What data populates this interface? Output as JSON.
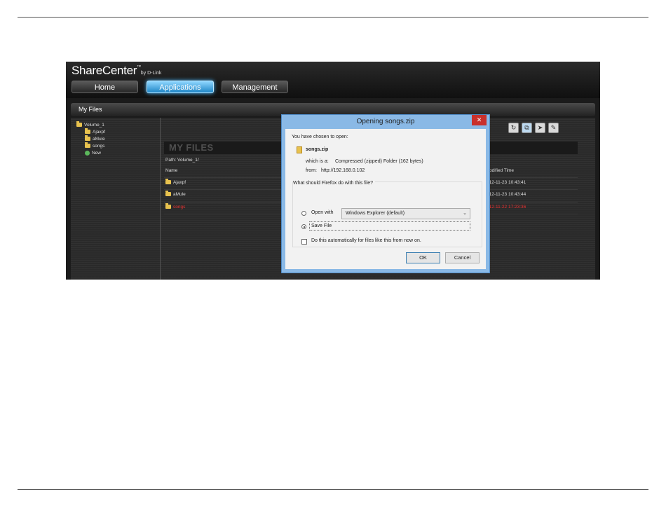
{
  "app": {
    "brand": "ShareCenter",
    "brand_tm": "™",
    "brand_by": "by D-Link"
  },
  "nav": {
    "home": "Home",
    "applications": "Applications",
    "management": "Management"
  },
  "panel": {
    "title": "My Files",
    "heading": "MY FILES",
    "path": "Path:  Volume_1/",
    "columns": {
      "name": "Name",
      "modified": "odified Time"
    }
  },
  "tree": {
    "root": "Volume_1",
    "items": [
      "Ajaxpf",
      "aMule",
      "songs"
    ],
    "new_label": "New"
  },
  "files": [
    {
      "name": "Ajaxpf",
      "time": "012-11-23 10:43:41",
      "selected": false
    },
    {
      "name": "aMule",
      "time": "012-11-23 10:43:44",
      "selected": false
    },
    {
      "name": "songs",
      "time": "012-11-22 17:23:36",
      "selected": true
    }
  ],
  "toolbar_icons": [
    "refresh-icon",
    "copy-icon",
    "move-icon",
    "tag-icon"
  ],
  "dialog": {
    "title": "Opening songs.zip",
    "close": "✕",
    "chosen": "You have chosen to open:",
    "filename": "songs.zip",
    "which_is_label": "which is a:",
    "which_is_value": "Compressed (zipped) Folder (162 bytes)",
    "from_label": "from:",
    "from_value": "http://192.168.0.102",
    "question": "What should Firefox do with this file?",
    "open_with": "Open with",
    "open_with_app": "Windows Explorer (default)",
    "save_file": "Save File",
    "auto": "Do this automatically for files like this from now on.",
    "ok": "OK",
    "cancel": "Cancel",
    "selected_option": "save_file",
    "auto_checked": false
  },
  "colors": {
    "accent": "#1f86c6",
    "selected_file": "#e53030",
    "dialog_frame": "#8ab9e6"
  }
}
